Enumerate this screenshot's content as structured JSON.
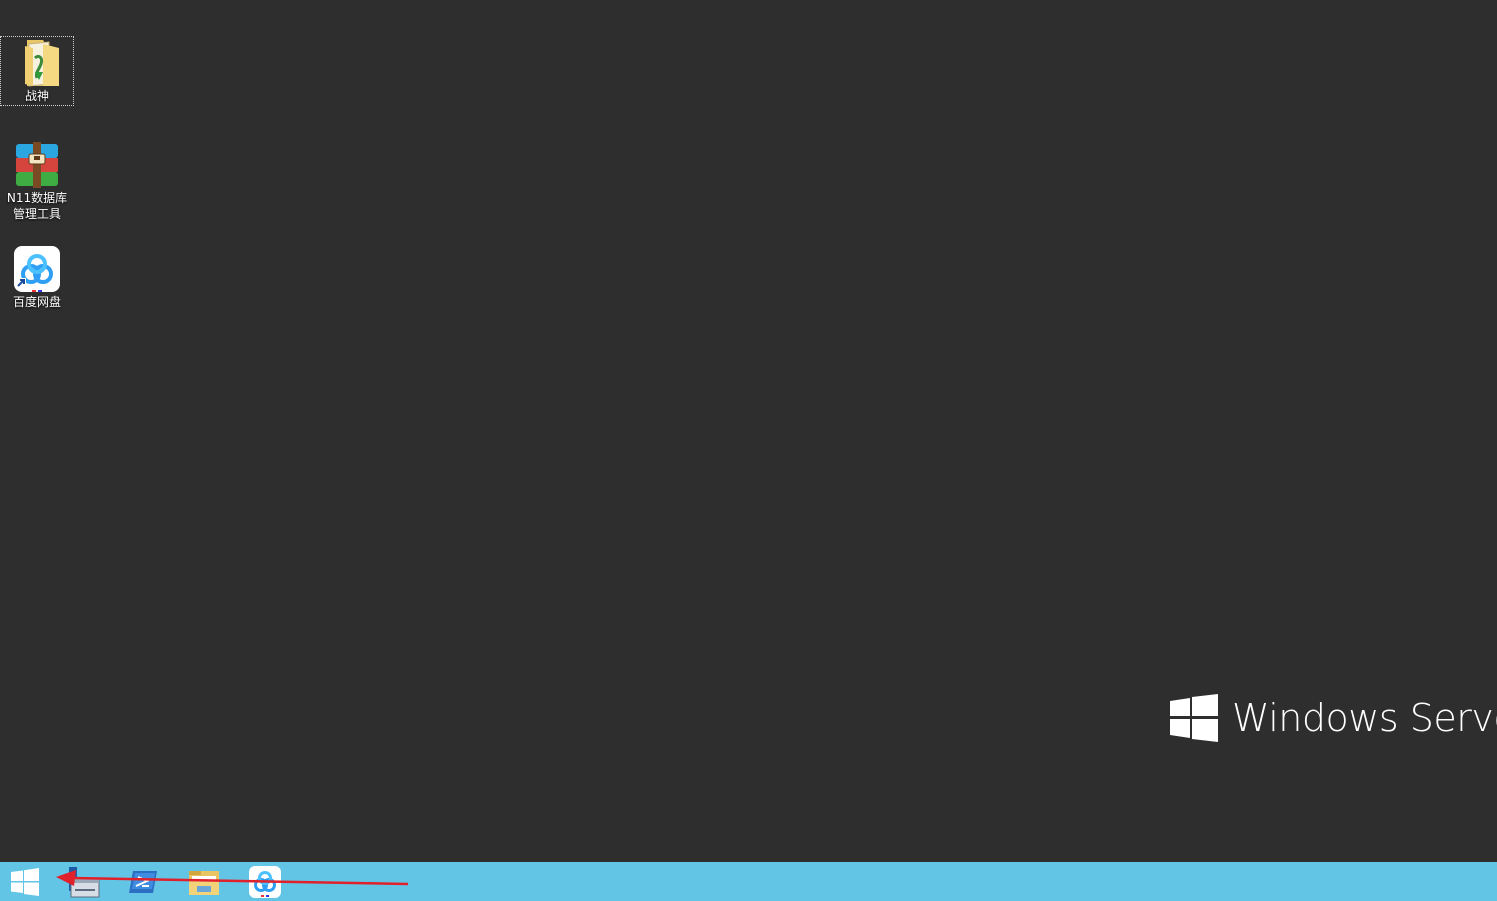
{
  "desktop": {
    "icons": [
      {
        "label": "战神",
        "icon": "folder-icon",
        "selected": true
      },
      {
        "label": "N11数据库管理工具",
        "icon": "winrar-archive-icon",
        "selected": false
      },
      {
        "label": "百度网盘",
        "icon": "baidu-netdisk-icon",
        "selected": false
      }
    ],
    "branding": {
      "text": "Windows Server",
      "icon": "windows-logo-icon"
    }
  },
  "taskbar": {
    "items": [
      {
        "name": "start-button",
        "icon": "windows-logo-icon"
      },
      {
        "name": "server-manager",
        "icon": "server-manager-icon"
      },
      {
        "name": "powershell",
        "icon": "powershell-icon"
      },
      {
        "name": "file-explorer",
        "icon": "file-explorer-icon"
      },
      {
        "name": "baidu-netdisk",
        "icon": "baidu-netdisk-icon"
      }
    ]
  },
  "colors": {
    "desktop_bg": "#2e2e2e",
    "taskbar_bg": "#63c5e6",
    "annotation_arrow": "#e0202a"
  },
  "annotation": {
    "type": "arrow",
    "direction": "left",
    "points_to": "start-button"
  }
}
